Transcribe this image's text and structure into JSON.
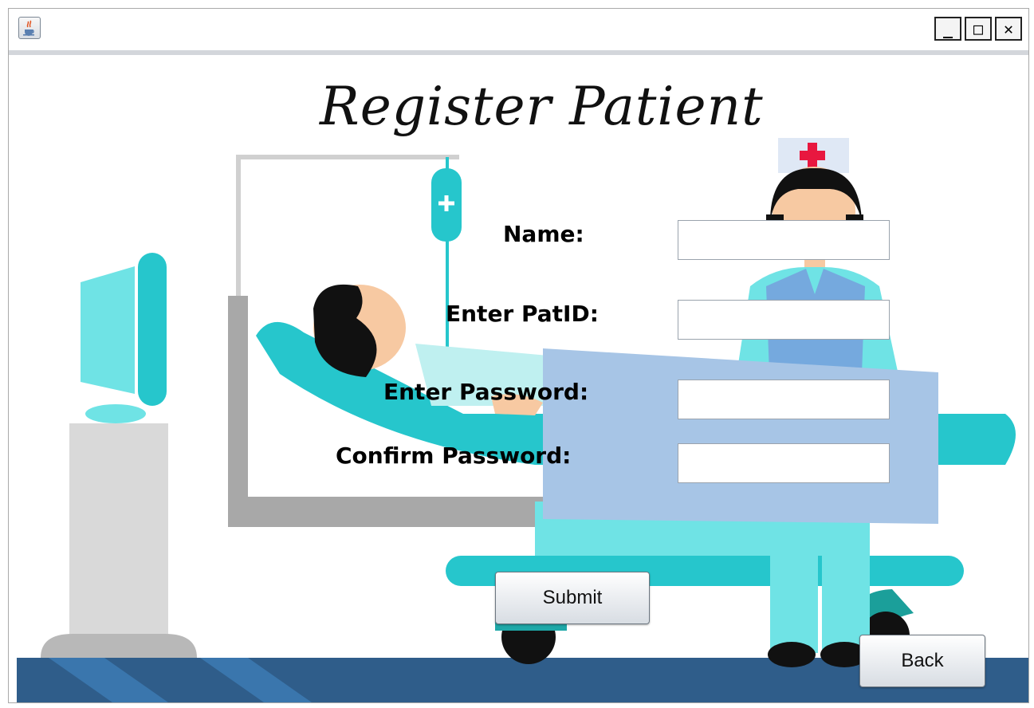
{
  "window": {
    "icon": "java-cup-icon",
    "controls": {
      "minimize": "_",
      "maximize": "□",
      "close": "✕"
    }
  },
  "page": {
    "title": "Register Patient"
  },
  "form": {
    "name_label": "Name:",
    "name_value": "",
    "patid_label": "Enter PatID:",
    "patid_value": "",
    "password_label": "Enter Password:",
    "password_value": "",
    "confirm_label": "Confirm Password:",
    "confirm_value": ""
  },
  "buttons": {
    "submit_label": "Submit",
    "back_label": "Back"
  },
  "colors": {
    "teal": "#26c6cc",
    "light_teal": "#6fe3e5",
    "blanket": "#a7c5e6",
    "floor": "#2f5d8a",
    "gray": "#a8a8a8"
  }
}
